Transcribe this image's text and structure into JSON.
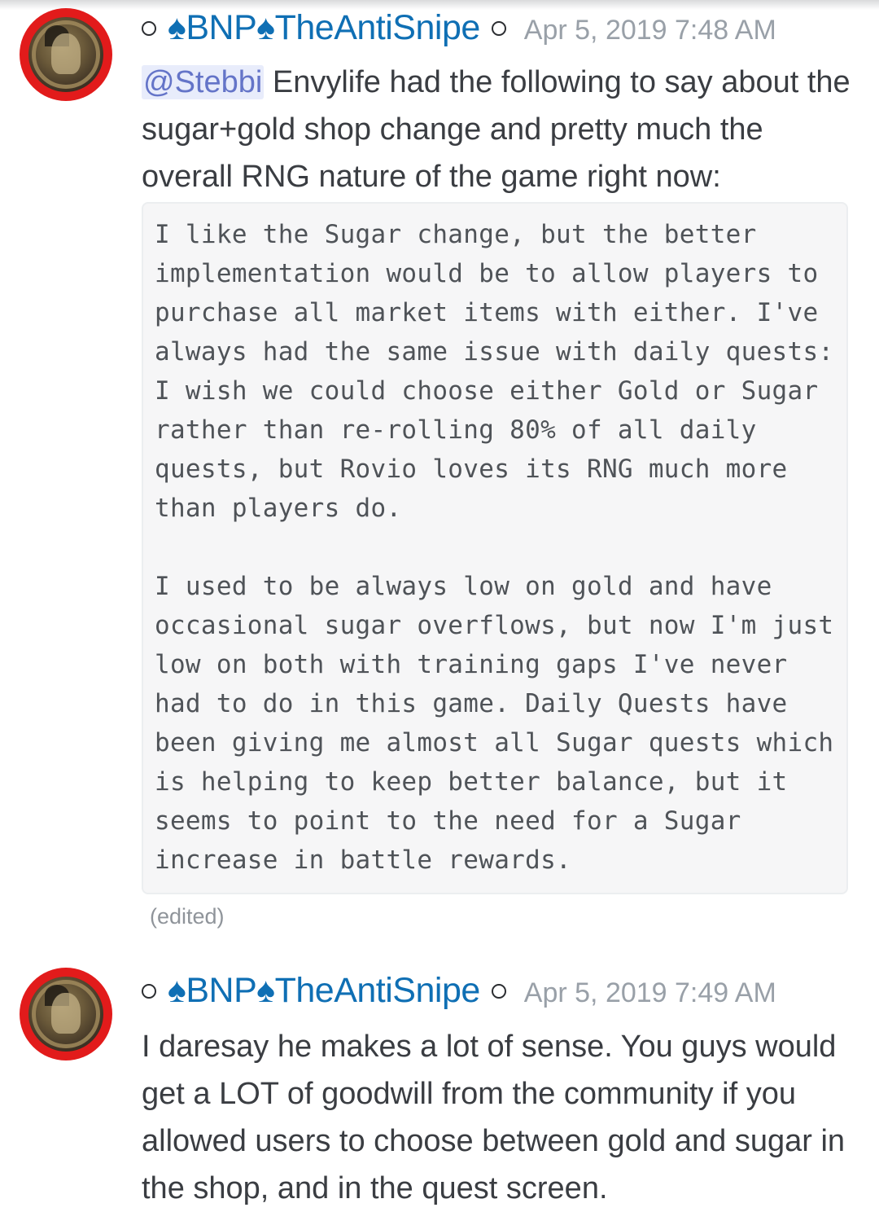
{
  "messages": [
    {
      "username": "BNP",
      "username_suffix": "TheAntiSnipe",
      "timestamp": "Apr 5, 2019 7:48 AM",
      "mention": "@Stebbi",
      "text": " Envylife had the following to say about the sugar+gold shop change and pretty much the overall RNG nature of the game right now:",
      "code_paragraphs": [
        "I like the Sugar change, but the better implementation would be to allow players to purchase all market items with either. I've always had the same issue with daily quests: I wish we could choose either Gold or Sugar rather than re-rolling 80% of all daily quests, but Rovio loves its RNG much more than players do.",
        "I used to be always low on gold and have occasional sugar overflows, but now I'm just low on both with training gaps I've never had to do in this game. Daily Quests have been giving me almost all Sugar quests which is helping to keep better balance, but it seems to point to the need for a Sugar increase in battle rewards."
      ],
      "edited_label": "(edited)"
    },
    {
      "username": "BNP",
      "username_suffix": "TheAntiSnipe",
      "timestamp": "Apr 5, 2019 7:49 AM",
      "text": "I daresay he makes a lot of sense. You guys would get a LOT of goodwill from the community if you allowed users to choose between gold and sugar in the shop, and in the quest screen."
    }
  ],
  "colors": {
    "username": "#0f6fb4",
    "timestamp": "#99a0a8",
    "mention_bg": "#e8ecfb",
    "mention_text": "#6474c8",
    "avatar_border": "#e21b1b",
    "code_bg": "#f6f6f7"
  },
  "icons": [
    "status-ring-icon",
    "spade-icon",
    "avatar-medallion"
  ]
}
